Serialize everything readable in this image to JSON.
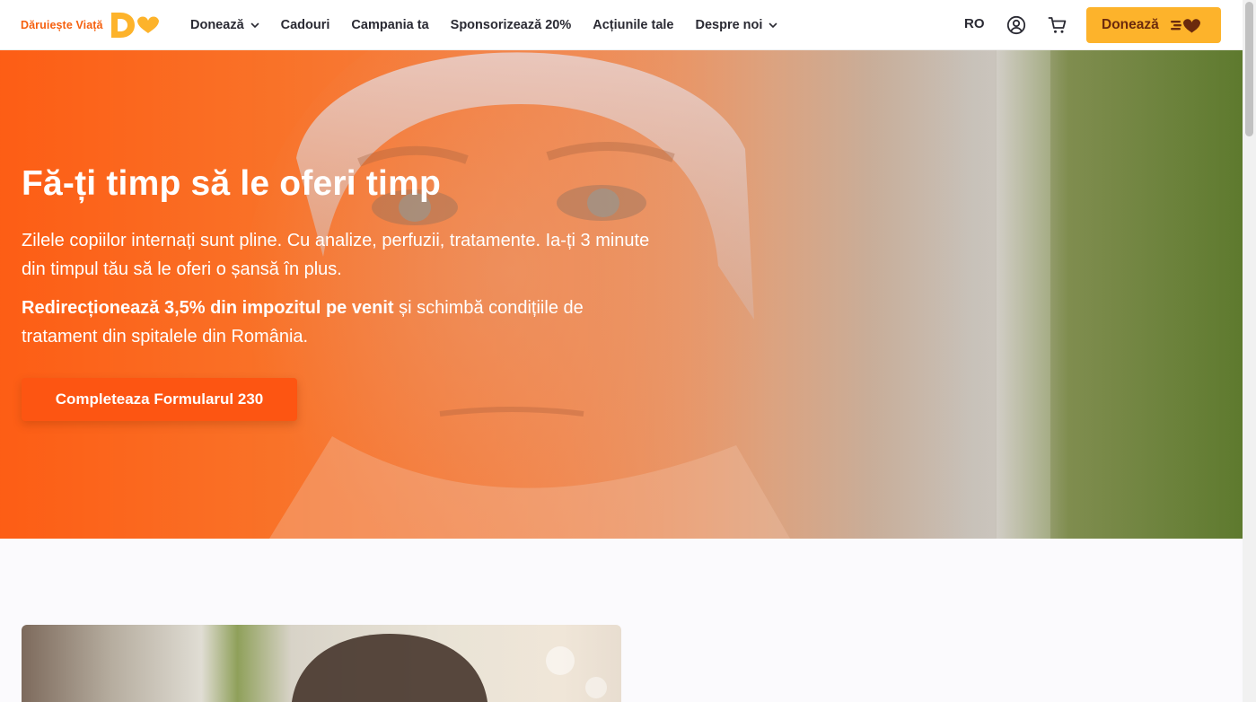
{
  "nav": {
    "logo_text": "Dăruiește Viață",
    "items": [
      {
        "label": "Donează",
        "dropdown": true
      },
      {
        "label": "Cadouri",
        "dropdown": false
      },
      {
        "label": "Campania ta",
        "dropdown": false
      },
      {
        "label": "Sponsorizează 20%",
        "dropdown": false
      },
      {
        "label": "Acțiunile tale",
        "dropdown": false
      },
      {
        "label": "Despre noi",
        "dropdown": true
      }
    ],
    "lang": "RO",
    "donate_label": "Donează",
    "icons": [
      "user-icon",
      "cart-icon",
      "chevron-down-icon"
    ]
  },
  "hero": {
    "title": "Fă-ți timp să le oferi timp",
    "p1": "Zilele copiilor internați sunt pline. Cu analize, perfuzii, tratamente. Ia-ți 3 minute din timpul tău să le oferi o șansă în plus.",
    "p2_bold": "Redirecționează 3,5% din impozitul pe venit",
    "p2_rest": " și schimbă condițiile de tratament din spitalele din România.",
    "cta_label": "Completeaza Formularul 230"
  },
  "colors": {
    "brand_orange": "#fd5512",
    "donate_yellow": "#fdb32b",
    "donate_text": "#6b2a0d",
    "logo_orange": "#f5600f"
  }
}
